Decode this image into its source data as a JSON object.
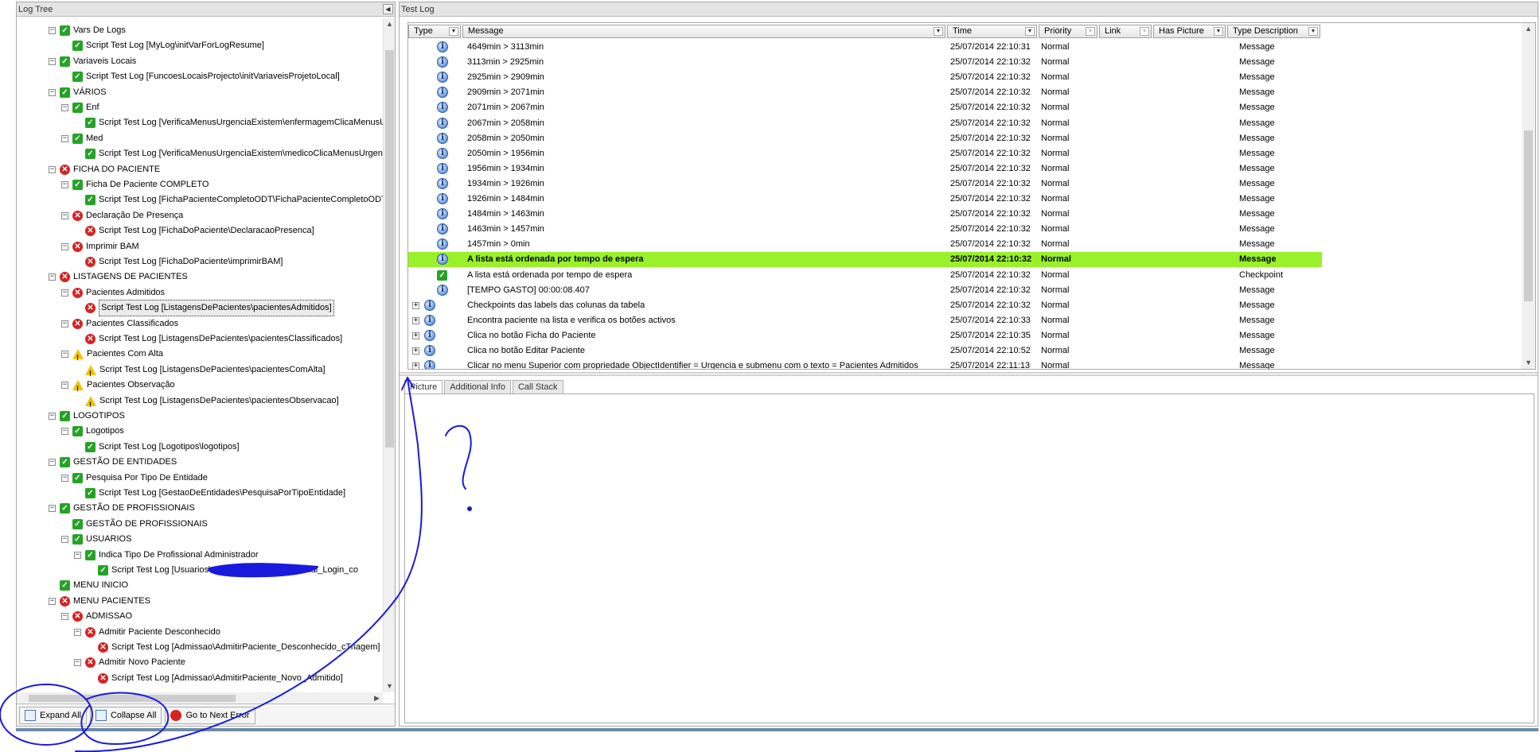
{
  "log_tree": {
    "title": "Log Tree",
    "nodes": [
      {
        "label": "Vars De Logs",
        "status": "ok",
        "level": 3,
        "expander": "minus"
      },
      {
        "label": "Script Test Log [MyLog\\initVarForLogResume]",
        "status": "ok",
        "level": 4,
        "expander": ""
      },
      {
        "label": "Variaveis Locais",
        "status": "ok",
        "level": 3,
        "expander": "minus"
      },
      {
        "label": "Script Test Log [FuncoesLocaisProjecto\\initVariaveisProjetoLocal]",
        "status": "ok",
        "level": 4,
        "expander": ""
      },
      {
        "label": "VÁRIOS",
        "status": "ok",
        "level": 3,
        "expander": "minus"
      },
      {
        "label": "Enf",
        "status": "ok",
        "level": 4,
        "expander": "minus"
      },
      {
        "label": "Script Test Log [VerificaMenusUrgenciaExistem\\enfermagemClicaMenusUr",
        "status": "ok",
        "level": 5,
        "expander": ""
      },
      {
        "label": "Med",
        "status": "ok",
        "level": 4,
        "expander": "minus"
      },
      {
        "label": "Script Test Log [VerificaMenusUrgenciaExistem\\medicoClicaMenusUrgenc",
        "status": "ok",
        "level": 5,
        "expander": ""
      },
      {
        "label": "FICHA DO PACIENTE",
        "status": "err",
        "level": 3,
        "expander": "minus"
      },
      {
        "label": "Ficha De Paciente COMPLETO",
        "status": "ok",
        "level": 4,
        "expander": "minus"
      },
      {
        "label": "Script Test Log [FichaPacienteCompletoODT\\FichaPacienteCompletoODT]",
        "status": "ok",
        "level": 5,
        "expander": ""
      },
      {
        "label": "Declaração De Presença",
        "status": "err",
        "level": 4,
        "expander": "minus"
      },
      {
        "label": "Script Test Log [FichaDoPaciente\\DeclaracaoPresenca]",
        "status": "err",
        "level": 5,
        "expander": ""
      },
      {
        "label": "Imprimir BAM",
        "status": "err",
        "level": 4,
        "expander": "minus"
      },
      {
        "label": "Script Test Log [FichaDoPaciente\\imprimirBAM]",
        "status": "err",
        "level": 5,
        "expander": ""
      },
      {
        "label": "LISTAGENS DE PACIENTES",
        "status": "err",
        "level": 3,
        "expander": "minus"
      },
      {
        "label": "Pacientes Admitidos",
        "status": "err",
        "level": 4,
        "expander": "minus"
      },
      {
        "label": "Script Test Log [ListagensDePacientes\\pacientesAdmitidos]",
        "status": "err",
        "level": 5,
        "expander": "",
        "selected": true
      },
      {
        "label": "Pacientes Classificados",
        "status": "err",
        "level": 4,
        "expander": "minus"
      },
      {
        "label": "Script Test Log [ListagensDePacientes\\pacientesClassificados]",
        "status": "err",
        "level": 5,
        "expander": ""
      },
      {
        "label": "Pacientes Com Alta",
        "status": "warn",
        "level": 4,
        "expander": "minus"
      },
      {
        "label": "Script Test Log [ListagensDePacientes\\pacientesComAlta]",
        "status": "warn",
        "level": 5,
        "expander": ""
      },
      {
        "label": "Pacientes Observação",
        "status": "warn",
        "level": 4,
        "expander": "minus"
      },
      {
        "label": "Script Test Log [ListagensDePacientes\\pacientesObservacao]",
        "status": "warn",
        "level": 5,
        "expander": ""
      },
      {
        "label": "LOGOTIPOS",
        "status": "ok",
        "level": 3,
        "expander": "minus"
      },
      {
        "label": "Logotipos",
        "status": "ok",
        "level": 4,
        "expander": "minus"
      },
      {
        "label": "Script Test Log [Logotipos\\logotipos]",
        "status": "ok",
        "level": 5,
        "expander": ""
      },
      {
        "label": "GESTÃO DE ENTIDADES",
        "status": "ok",
        "level": 3,
        "expander": "minus"
      },
      {
        "label": "Pesquisa Por Tipo De Entidade",
        "status": "ok",
        "level": 4,
        "expander": "minus"
      },
      {
        "label": "Script Test Log [GestaoDeEntidades\\PesquisaPorTipoEntidade]",
        "status": "ok",
        "level": 5,
        "expander": ""
      },
      {
        "label": "GESTÃO DE PROFISSIONAIS",
        "status": "ok",
        "level": 3,
        "expander": "minus"
      },
      {
        "label": "GESTÃO DE PROFISSIONAIS",
        "status": "ok",
        "level": 4,
        "expander": ""
      },
      {
        "label": "USUARIOS",
        "status": "ok",
        "level": 4,
        "expander": "minus"
      },
      {
        "label": "Indica Tipo De Profissional Administrador",
        "status": "ok",
        "level": 5,
        "expander": "minus"
      },
      {
        "label": "Script Test Log [Usuarios\\",
        "status": "ok",
        "level": 6,
        "expander": "",
        "redacted": true,
        "suffix": "sal_Login_co"
      },
      {
        "label": "MENU INICIO",
        "status": "ok",
        "level": 3,
        "expander": ""
      },
      {
        "label": "MENU PACIENTES",
        "status": "err",
        "level": 3,
        "expander": "minus"
      },
      {
        "label": "ADMISSAO",
        "status": "err",
        "level": 4,
        "expander": "minus"
      },
      {
        "label": "Admitir Paciente Desconhecido",
        "status": "err",
        "level": 5,
        "expander": "minus"
      },
      {
        "label": "Script Test Log [Admissao\\AdmitirPaciente_Desconhecido_cTriagem]",
        "status": "err",
        "level": 6,
        "expander": ""
      },
      {
        "label": "Admitir Novo Paciente",
        "status": "err",
        "level": 5,
        "expander": "minus"
      },
      {
        "label": "Script Test Log [Admissao\\AdmitirPaciente_Novo_Admitido]",
        "status": "err",
        "level": 6,
        "expander": ""
      }
    ],
    "toolbar": {
      "expand_all": "Expand All",
      "collapse_all": "Collapse All",
      "next_error": "Go to Next Error"
    }
  },
  "test_log": {
    "title": "Test Log",
    "columns": [
      {
        "label": "Type",
        "dropdown": true
      },
      {
        "label": "Message",
        "dropdown": true
      },
      {
        "label": "Time",
        "dropdown": true
      },
      {
        "label": "Priority",
        "dropdown": true,
        "dim_dropdown": true
      },
      {
        "label": "Link",
        "dropdown": true,
        "dim_dropdown": true
      },
      {
        "label": "Has Picture",
        "dropdown": true
      },
      {
        "label": "Type Description",
        "dropdown": true
      }
    ],
    "rows": [
      {
        "icon": "message-icon",
        "message": "4649min > 3113min",
        "time": "25/07/2014 22:10:31",
        "priority": "Normal",
        "type_description": "Message"
      },
      {
        "icon": "message-icon",
        "message": "3113min > 2925min",
        "time": "25/07/2014 22:10:32",
        "priority": "Normal",
        "type_description": "Message"
      },
      {
        "icon": "message-icon",
        "message": "2925min > 2909min",
        "time": "25/07/2014 22:10:32",
        "priority": "Normal",
        "type_description": "Message"
      },
      {
        "icon": "message-icon",
        "message": "2909min > 2071min",
        "time": "25/07/2014 22:10:32",
        "priority": "Normal",
        "type_description": "Message"
      },
      {
        "icon": "message-icon",
        "message": "2071min > 2067min",
        "time": "25/07/2014 22:10:32",
        "priority": "Normal",
        "type_description": "Message"
      },
      {
        "icon": "message-icon",
        "message": "2067min > 2058min",
        "time": "25/07/2014 22:10:32",
        "priority": "Normal",
        "type_description": "Message"
      },
      {
        "icon": "message-icon",
        "message": "2058min > 2050min",
        "time": "25/07/2014 22:10:32",
        "priority": "Normal",
        "type_description": "Message"
      },
      {
        "icon": "message-icon",
        "message": "2050min > 1956min",
        "time": "25/07/2014 22:10:32",
        "priority": "Normal",
        "type_description": "Message"
      },
      {
        "icon": "message-icon",
        "message": "1956min > 1934min",
        "time": "25/07/2014 22:10:32",
        "priority": "Normal",
        "type_description": "Message"
      },
      {
        "icon": "message-icon",
        "message": "1934min > 1926min",
        "time": "25/07/2014 22:10:32",
        "priority": "Normal",
        "type_description": "Message"
      },
      {
        "icon": "message-icon",
        "message": "1926min > 1484min",
        "time": "25/07/2014 22:10:32",
        "priority": "Normal",
        "type_description": "Message"
      },
      {
        "icon": "message-icon",
        "message": "1484min > 1463min",
        "time": "25/07/2014 22:10:32",
        "priority": "Normal",
        "type_description": "Message"
      },
      {
        "icon": "message-icon",
        "message": "1463min > 1457min",
        "time": "25/07/2014 22:10:32",
        "priority": "Normal",
        "type_description": "Message"
      },
      {
        "icon": "message-icon",
        "message": "1457min > 0min",
        "time": "25/07/2014 22:10:32",
        "priority": "Normal",
        "type_description": "Message"
      },
      {
        "icon": "message-icon",
        "message": "A lista está ordenada por tempo de espera",
        "time": "25/07/2014 22:10:32",
        "priority": "Normal",
        "type_description": "Message",
        "highlight": true
      },
      {
        "icon": "checkpoint-icon",
        "message": "A lista está ordenada por tempo de espera",
        "time": "25/07/2014 22:10:32",
        "priority": "Normal",
        "type_description": "Checkpoint"
      },
      {
        "icon": "message-icon",
        "message": "[TEMPO GASTO] 00:00:08.407",
        "time": "25/07/2014 22:10:32",
        "priority": "Normal",
        "type_description": "Message"
      },
      {
        "icon": "message-icon",
        "message": "Checkpoints das labels das colunas da tabela",
        "time": "25/07/2014 22:10:32",
        "priority": "Normal",
        "type_description": "Message",
        "expandable": true
      },
      {
        "icon": "message-icon",
        "message": "Encontra paciente na lista e verifica os botões activos",
        "time": "25/07/2014 22:10:33",
        "priority": "Normal",
        "type_description": "Message",
        "expandable": true
      },
      {
        "icon": "message-icon",
        "message": "Clica no botão Ficha do Paciente",
        "time": "25/07/2014 22:10:35",
        "priority": "Normal",
        "type_description": "Message",
        "expandable": true
      },
      {
        "icon": "message-icon",
        "message": "Clica no botão Editar Paciente",
        "time": "25/07/2014 22:10:52",
        "priority": "Normal",
        "type_description": "Message",
        "expandable": true
      },
      {
        "icon": "message-icon",
        "message": "Clicar no menu Superior com propriedade ObjectIdentifier = Urgencia e submenu com o texto = Pacientes Admitidos",
        "time": "25/07/2014 22:11:13",
        "priority": "Normal",
        "type_description": "Message",
        "expandable": true
      }
    ],
    "detail_tabs": [
      "Picture",
      "Additional Info",
      "Call Stack"
    ],
    "active_tab": "Picture"
  },
  "colors": {
    "highlight_row": "#99f12a",
    "ok": "#26a326",
    "error": "#d62222",
    "warning": "#f2c200",
    "annotation_ink": "#1a1adc"
  }
}
